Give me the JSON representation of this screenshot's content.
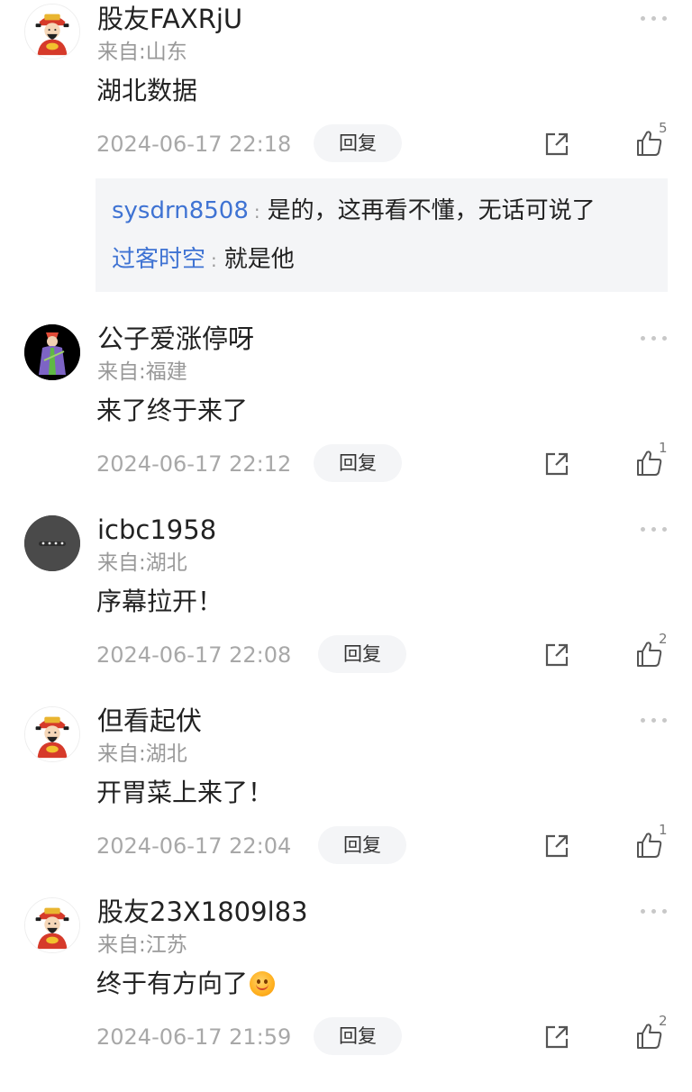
{
  "comments": [
    {
      "name": "股友FAXRjU",
      "location": "来自:山东",
      "text": "湖北数据",
      "time": "2024-06-17 22:18",
      "reply_label": "回复",
      "likes": "5",
      "avatar_icon": "god-of-wealth-avatar-icon",
      "replies": [
        {
          "user": "sysdrn8508",
          "sep": ":",
          "text": "是的，这再看不懂，无话可说了"
        },
        {
          "user": "过客时空",
          "sep": ":",
          "text": "就是他"
        }
      ]
    },
    {
      "name": "公子爱涨停呀",
      "location": "来自:福建",
      "text": "来了终于来了",
      "time": "2024-06-17 22:12",
      "reply_label": "回复",
      "likes": "1",
      "avatar_icon": "character-avatar-icon"
    },
    {
      "name": "icbc1958",
      "location": "来自:湖北",
      "text": "序幕拉开！",
      "time": "2024-06-17 22:08",
      "reply_label": "回复",
      "likes": "2",
      "avatar_icon": "grey-face-avatar-icon"
    },
    {
      "name": "但看起伏",
      "location": "来自:湖北",
      "text": "开胃菜上来了！",
      "time": "2024-06-17 22:04",
      "reply_label": "回复",
      "likes": "1",
      "avatar_icon": "god-of-wealth-avatar-icon"
    },
    {
      "name": "股友23X1809l83",
      "location": "来自:江苏",
      "text": "终于有方向了",
      "emoji": "smile-emoji-icon",
      "time": "2024-06-17 21:59",
      "reply_label": "回复",
      "likes": "2",
      "avatar_icon": "god-of-wealth-avatar-icon"
    }
  ],
  "colors": {
    "link_blue": "#3f73d3",
    "muted_gray": "#a8a8a8",
    "reply_bg": "#f4f5f7"
  }
}
